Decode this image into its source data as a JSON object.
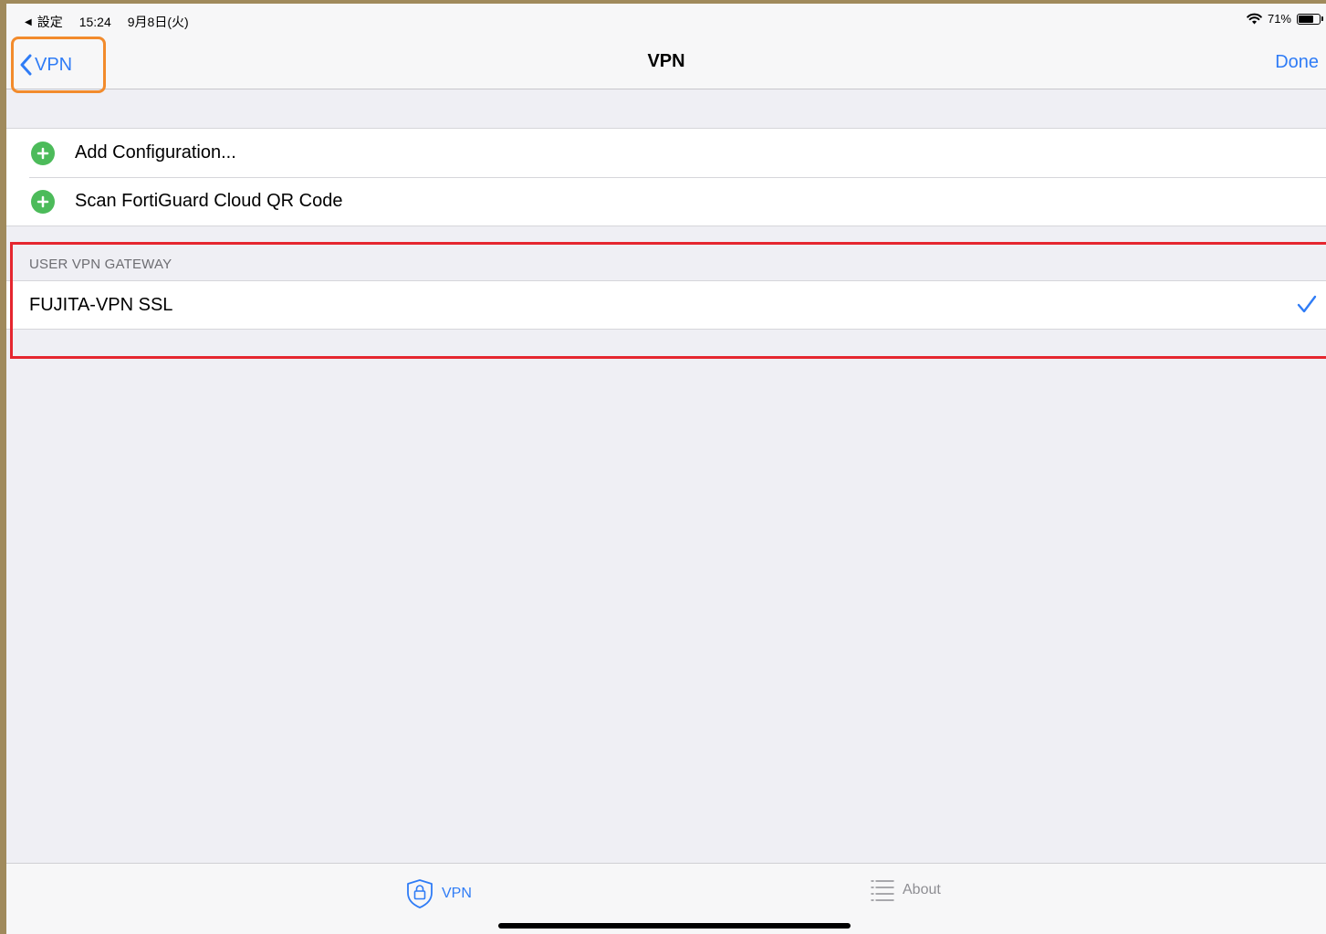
{
  "statusbar": {
    "back_app": "設定",
    "time": "15:24",
    "date": "9月8日(火)",
    "battery": "71%",
    "battery_level": 0.71
  },
  "navbar": {
    "back_label": "VPN",
    "title": "VPN",
    "done_label": "Done"
  },
  "actions": [
    {
      "label": "Add Configuration..."
    },
    {
      "label": "Scan FortiGuard Cloud QR Code"
    }
  ],
  "gateway_section": {
    "header": "USER VPN GATEWAY",
    "items": [
      {
        "label": "FUJITA-VPN SSL",
        "selected": true
      }
    ]
  },
  "tabbar": {
    "tabs": [
      {
        "label": "VPN",
        "icon": "shield-lock-icon",
        "active": true
      },
      {
        "label": "About",
        "icon": "list-icon",
        "active": false
      }
    ]
  },
  "colors": {
    "accent": "#2f7cf6",
    "add_green": "#4cbb5a",
    "highlight_red": "#e5262f",
    "highlight_orange": "#f28b2c",
    "frame": "#a08a5c"
  }
}
